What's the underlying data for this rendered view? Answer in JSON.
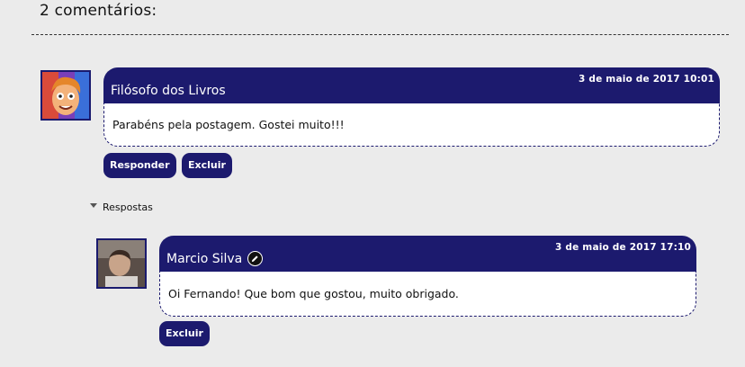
{
  "comments_heading": "2 comentários:",
  "comment1": {
    "author": "Filósofo dos Livros",
    "date": "3 de maio de 2017 10:01",
    "text": "Parabéns pela postagem. Gostei muito!!!",
    "reply_label": "Responder",
    "delete_label": "Excluir"
  },
  "replies_toggle": "Respostas",
  "reply1": {
    "author": "Marcio Silva",
    "date": "3 de maio de 2017 17:10",
    "text": "Oi Fernando! Que bom que gostou, muito obrigado.",
    "delete_label": "Excluir",
    "edit_icon": "pencil-icon"
  },
  "colors": {
    "accent": "#1c1a6e",
    "background": "#ebebeb",
    "body_bg": "#ffffff"
  }
}
